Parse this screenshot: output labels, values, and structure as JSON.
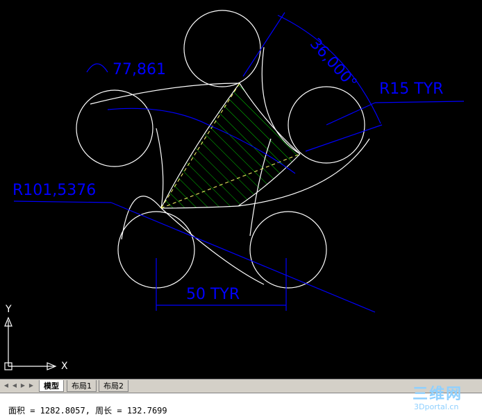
{
  "drawing": {
    "angle_dim": "36,000°",
    "arc_length_dim": "77,861",
    "radius_small": "R15 TYR",
    "radius_large": "R101,5376",
    "linear_dim": "50 TYR",
    "ucs_y": "Y",
    "ucs_x": "X"
  },
  "colors": {
    "background": "#000000",
    "geometry": "#ffffff",
    "dimension": "#0000ff",
    "hatch": "#00cc00",
    "construction": "#ffff66"
  },
  "tabs": {
    "model": "模型",
    "layout1": "布局1",
    "layout2": "布局2"
  },
  "command": {
    "output": "面积 = 1282.8057, 周长 = 132.7699"
  },
  "watermark": {
    "brand": "三维网",
    "site": "3Dportal.cn"
  }
}
